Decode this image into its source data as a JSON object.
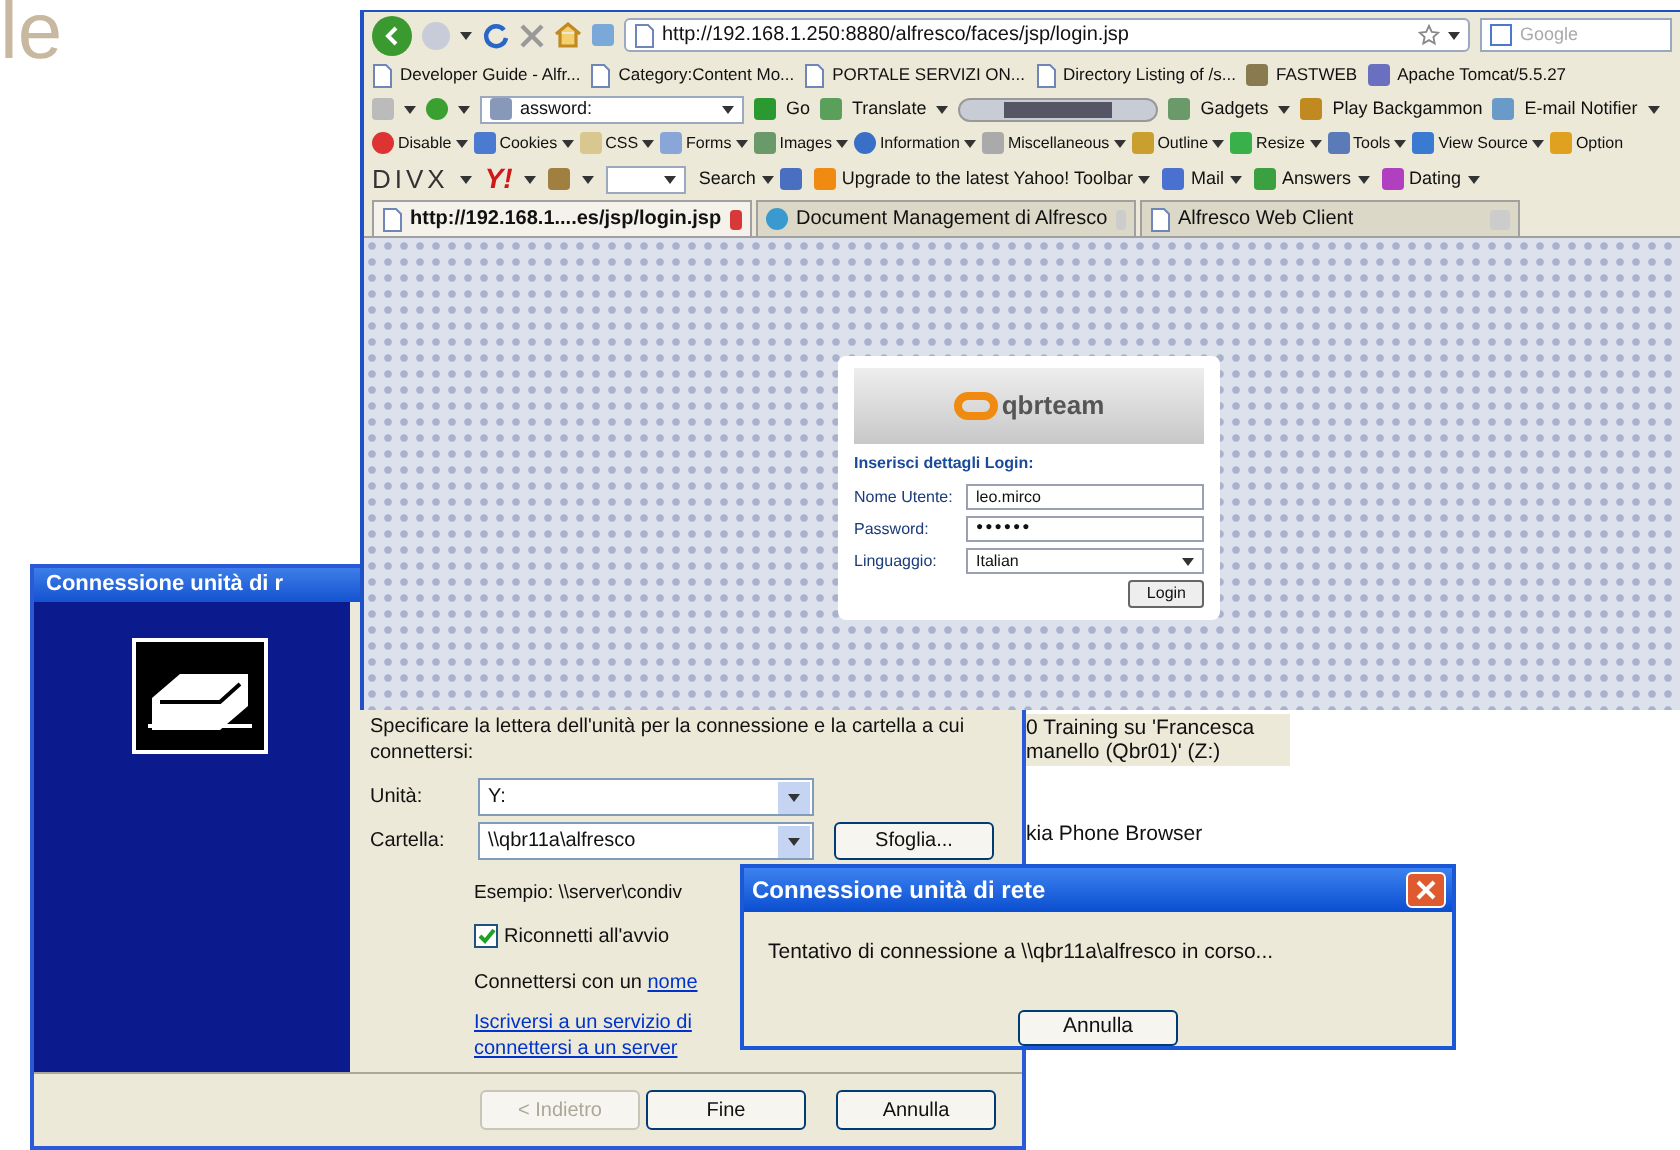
{
  "slide_title": "le",
  "browser": {
    "address": "http://192.168.1.250:8880/alfresco/faces/jsp/login.jsp",
    "search_placeholder": "Google",
    "bookmarks": [
      "Developer Guide - Alfr...",
      "Category:Content Mo...",
      "PORTALE SERVIZI ON...",
      "Directory Listing of /s...",
      "FASTWEB",
      "Apache Tomcat/5.5.27"
    ],
    "toolbar_search": "assword:",
    "toolbar_items": [
      "Go",
      "Translate",
      "Gadgets",
      "Play Backgammon",
      "E-mail Notifier"
    ],
    "dev_toolbar": [
      "Disable",
      "Cookies",
      "CSS",
      "Forms",
      "Images",
      "Information",
      "Miscellaneous",
      "Outline",
      "Resize",
      "Tools",
      "View Source",
      "Option"
    ],
    "divx_logo": "DIVX",
    "yahoo_logo": "Y!",
    "yahoo_items": [
      "Search",
      "Upgrade to the latest Yahoo! Toolbar",
      "Mail",
      "Answers",
      "Dating"
    ],
    "tabs": [
      {
        "label": "http://192.168.1....es/jsp/login.jsp",
        "selected": true
      },
      {
        "label": "Document Management di Alfresco",
        "selected": false
      },
      {
        "label": "Alfresco Web Client",
        "selected": false
      }
    ],
    "login": {
      "logo": "qbrteam",
      "heading": "Inserisci dettagli Login:",
      "fields": [
        {
          "kind": "text",
          "label": "Nome Utente:",
          "value": "leo.mirco"
        },
        {
          "kind": "password",
          "label": "Password:",
          "value": "●●●●●●"
        },
        {
          "kind": "select",
          "label": "Linguaggio:",
          "value": "Italian"
        }
      ],
      "button": "Login"
    }
  },
  "wizard": {
    "title": "Connessione unità di r",
    "instruction": "Specificare la lettera dell'unità per la connessione e la cartella a cui connettersi:",
    "fields": [
      {
        "label": "Unità:",
        "value": "Y:"
      },
      {
        "label": "Cartella:",
        "value": "\\\\qbr11a\\alfresco"
      }
    ],
    "browse_button": "Sfoglia...",
    "example": "Esempio: \\\\server\\condiv",
    "reconnect": {
      "label": "Riconnetti all'avvio",
      "checked": true
    },
    "connect_as": "Connettersi con un",
    "connect_as_link": "nome",
    "signup_link": [
      "Iscriversi a un servizio di",
      "connettersi a un server"
    ],
    "buttons": [
      {
        "label": "< Indietro",
        "disabled": true
      },
      {
        "label": "Fine",
        "disabled": false
      },
      {
        "label": "Annulla",
        "disabled": false
      }
    ]
  },
  "explorer": {
    "items": [
      {
        "lines": [
          "0 Training su 'Francesca",
          "manello (Qbr01)' (Z:)"
        ],
        "selected": true
      },
      {
        "lines": [
          "kia Phone Browser"
        ],
        "selected": false
      }
    ]
  },
  "progress_dialog": {
    "title": "Connessione unità di rete",
    "message": "Tentativo di connessione a \\\\qbr11a\\alfresco in corso...",
    "button": "Annulla"
  }
}
